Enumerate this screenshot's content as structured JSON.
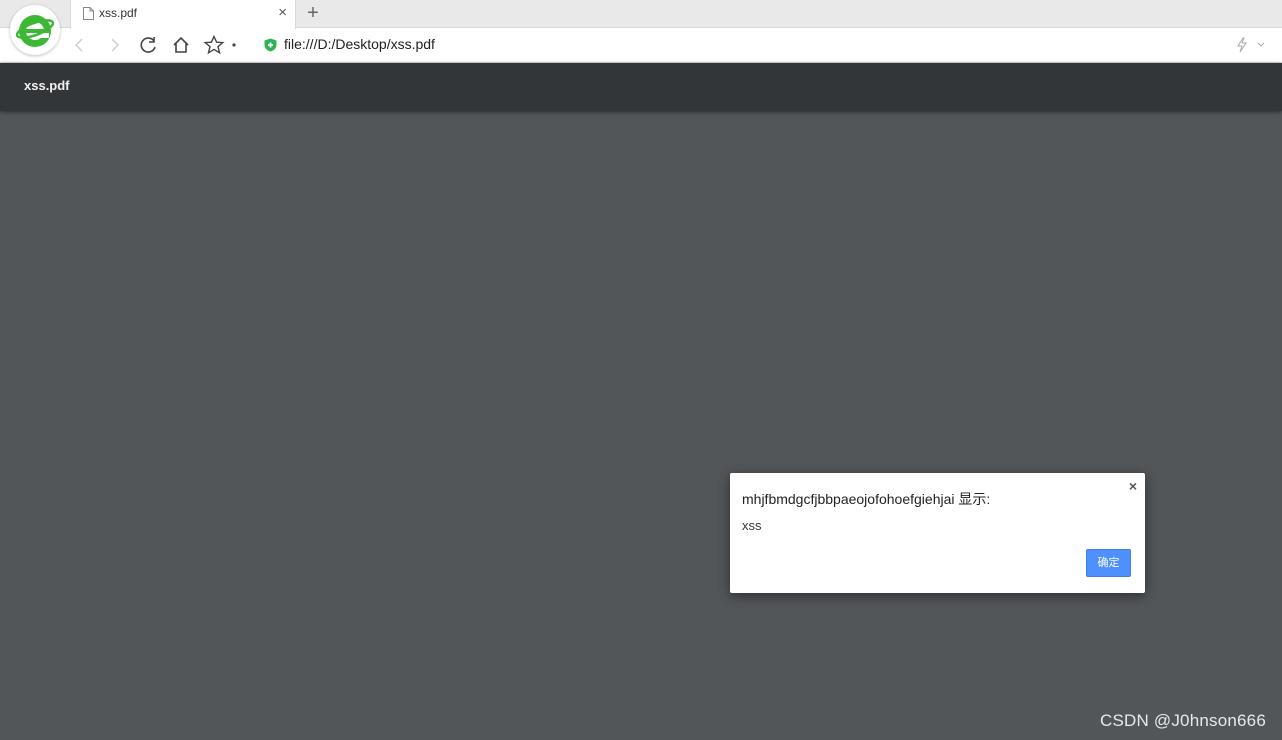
{
  "browser": {
    "logo_icon": "ie-e-logo-icon",
    "tab": {
      "title": "xss.pdf",
      "close_glyph": "×"
    },
    "new_tab_glyph": "+",
    "address_bar": {
      "url": "file:///D:/Desktop/xss.pdf"
    },
    "colors": {
      "logo_green": "#3cb834",
      "secure_shield": "#2fb455"
    }
  },
  "pdf_viewer": {
    "title": "xss.pdf",
    "toolbar_color": "#323639",
    "background_color": "#525659"
  },
  "dialog": {
    "title": "mhjfbmdgcfjbbpaeojofohoefgiehjai 显示:",
    "message": "xss",
    "ok_label": "确定",
    "close_glyph": "×",
    "button_color": "#4d90fe"
  },
  "watermark": "CSDN @J0hnson666"
}
